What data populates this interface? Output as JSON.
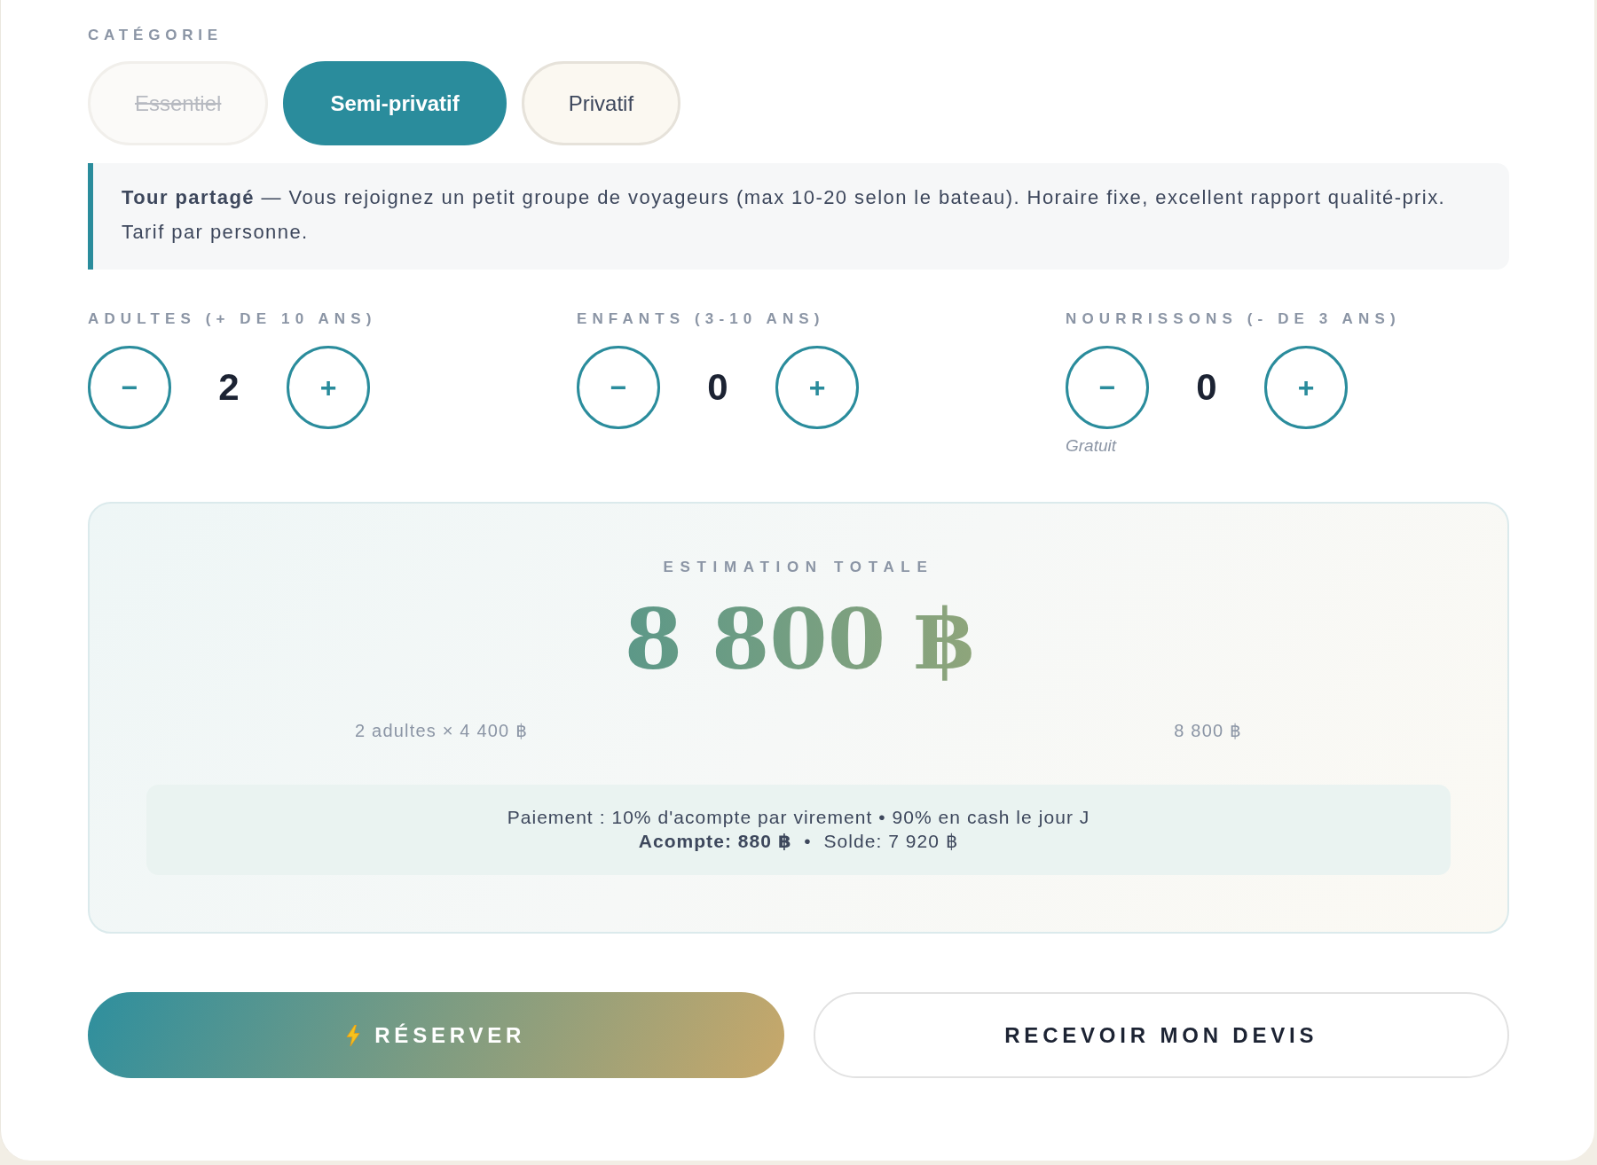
{
  "category": {
    "label": "CATÉGORIE",
    "options": [
      {
        "label": "Essentiel",
        "selected": false,
        "disabled": true
      },
      {
        "label": "Semi-privatif",
        "selected": true,
        "disabled": false
      },
      {
        "label": "Privatif",
        "selected": false,
        "disabled": false
      }
    ]
  },
  "description": "**Tour partagé** — Vous rejoignez un petit groupe de voyageurs (max 10-20 selon le bateau). Horaire fixe, excellent rapport qualité-prix. Tarif par personne.",
  "travelers": [
    {
      "label": "ADULTES (+ DE 10 ANS)",
      "decrement": "−",
      "value": "2",
      "increment": "+"
    },
    {
      "label": "ENFANTS (3-10 ANS)",
      "decrement": "−",
      "value": "0",
      "increment": "+"
    },
    {
      "label": "NOURRISSONS (- DE 3 ANS)",
      "decrement": "−",
      "value": "0",
      "increment": "+",
      "note": "Gratuit"
    }
  ],
  "estimate": {
    "label": "ESTIMATION TOTALE",
    "total": "8 800 ฿",
    "lines": [
      {
        "description": "2 adultes × 4 400 ฿",
        "amount": "8 800 ฿"
      }
    ],
    "payment": {
      "terms": "Paiement : 10% d'acompte par virement • 90% en cash le jour J",
      "split": "**Acompte: 880 ฿**  •  Solde: 7 920 ฿"
    }
  },
  "actions": [
    {
      "kind": "primary",
      "label": "RÉSERVER"
    },
    {
      "kind": "secondary",
      "label": "RECEVOIR MON DEVIS"
    }
  ]
}
